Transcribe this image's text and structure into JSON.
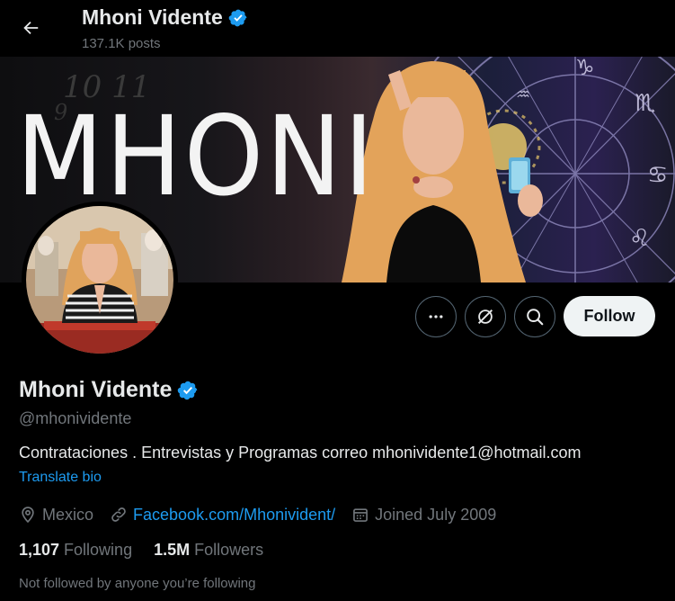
{
  "header": {
    "title": "Mhoni Vidente",
    "posts": "137.1K posts"
  },
  "banner": {
    "word": "MHONI"
  },
  "actions": {
    "follow_label": "Follow"
  },
  "profile": {
    "name": "Mhoni Vidente",
    "handle": "@mhonividente",
    "bio": "Contrataciones . Entrevistas y Programas correo mhonividente1@hotmail.com",
    "translate": "Translate bio",
    "location": "Mexico",
    "website": "Facebook.com/Mhonivident/",
    "joined": "Joined July 2009",
    "following_count": "1,107",
    "following_label": "Following",
    "followers_count": "1.5M",
    "followers_label": "Followers",
    "not_followed": "Not followed by anyone you’re following"
  },
  "colors": {
    "background": "#000000",
    "accent": "#1d9bf0",
    "text": "#e7e9ea",
    "muted": "#71767b"
  },
  "icons": [
    "back-arrow-icon",
    "verified-badge-icon",
    "more-icon",
    "grok-icon",
    "search-icon",
    "location-icon",
    "link-icon",
    "calendar-icon"
  ]
}
